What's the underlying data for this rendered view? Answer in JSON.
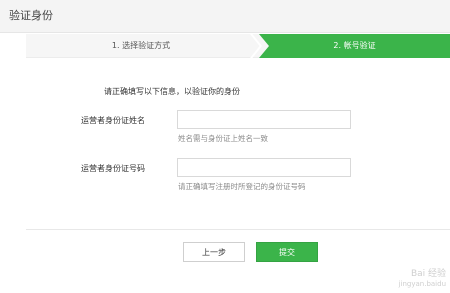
{
  "dialog": {
    "title": "验证身份"
  },
  "steps": [
    {
      "label": "1. 选择验证方式",
      "active": false
    },
    {
      "label": "2. 帐号验证",
      "active": true
    }
  ],
  "form": {
    "intro": "请正确填写以下信息，以验证你的身份",
    "fields": [
      {
        "label": "运营者身份证姓名",
        "value": "",
        "placeholder": "",
        "hint": "姓名需与身份证上姓名一致"
      },
      {
        "label": "运营者身份证号码",
        "value": "",
        "placeholder": "",
        "hint": "请正确填写注册时所登记的身份证号码"
      }
    ]
  },
  "buttons": {
    "prev": "上一步",
    "submit": "提交"
  },
  "watermark": {
    "text": "Bai 经验",
    "url": "jingyan.baidu"
  },
  "colors": {
    "accent": "#3bb44a",
    "topbar": "#f4f4f4",
    "hint": "#8a8a8a"
  }
}
